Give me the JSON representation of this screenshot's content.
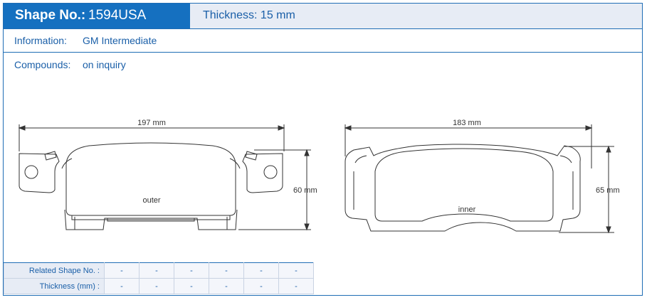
{
  "header": {
    "shape_label": "Shape No.:",
    "shape_value": "1594USA",
    "thickness_label": "Thickness:",
    "thickness_value": "15 mm"
  },
  "info": {
    "label": "Information:",
    "value": "GM Intermediate"
  },
  "compounds": {
    "label": "Compounds:",
    "value": "on inquiry"
  },
  "outer_pad": {
    "width": "197 mm",
    "height": "60 mm",
    "label": "outer"
  },
  "inner_pad": {
    "width": "183 mm",
    "height": "65 mm",
    "label": "inner"
  },
  "related": {
    "shape_header": "Related Shape No. :",
    "thickness_header": "Thickness (mm) :",
    "shape_values": [
      "-",
      "-",
      "-",
      "-",
      "-",
      "-"
    ],
    "thickness_values": [
      "-",
      "-",
      "-",
      "-",
      "-",
      "-"
    ]
  },
  "colors": {
    "accent": "#1570c0",
    "border": "#1f6db5",
    "text": "#1a5fa8",
    "header_bg": "#e7ecf5"
  }
}
